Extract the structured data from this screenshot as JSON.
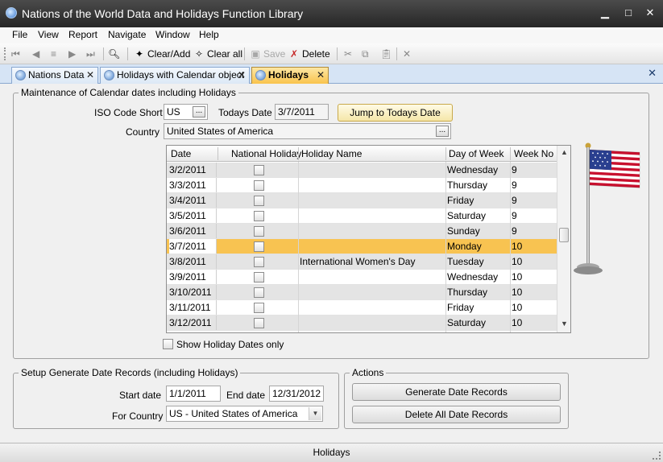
{
  "window": {
    "title": "Nations of the World Data and Holidays Function Library",
    "min": "▁",
    "max": "□",
    "close": "✕"
  },
  "menu": [
    "File",
    "View",
    "Report",
    "Navigate",
    "Window",
    "Help"
  ],
  "toolbar": {
    "clear_add": "Clear/Add",
    "clear_all": "Clear all",
    "save": "Save",
    "delete": "Delete"
  },
  "tabs": [
    {
      "label": "Nations Data",
      "active": false
    },
    {
      "label": "Holidays with Calendar object",
      "active": false
    },
    {
      "label": "Holidays",
      "active": true
    }
  ],
  "maint": {
    "legend": "Maintenance of Calendar dates including Holidays",
    "iso_label": "ISO Code Short",
    "iso_value": "US",
    "todays_label": "Todays Date",
    "todays_value": "3/7/2011",
    "jump_button": "Jump to Todays Date",
    "country_label": "Country",
    "country_value": "United States of America",
    "ellipsis": "...",
    "show_holidays_only": "Show Holiday Dates only"
  },
  "grid": {
    "columns": [
      "Date",
      "National Holiday",
      "Holiday Name",
      "Day of Week",
      "Week No"
    ],
    "rows": [
      {
        "date": "3/2/2011",
        "holiday": false,
        "name": "",
        "day": "Wednesday",
        "week": "9"
      },
      {
        "date": "3/3/2011",
        "holiday": false,
        "name": "",
        "day": "Thursday",
        "week": "9"
      },
      {
        "date": "3/4/2011",
        "holiday": false,
        "name": "",
        "day": "Friday",
        "week": "9"
      },
      {
        "date": "3/5/2011",
        "holiday": false,
        "name": "",
        "day": "Saturday",
        "week": "9"
      },
      {
        "date": "3/6/2011",
        "holiday": false,
        "name": "",
        "day": "Sunday",
        "week": "9"
      },
      {
        "date": "3/7/2011",
        "holiday": false,
        "name": "",
        "day": "Monday",
        "week": "10"
      },
      {
        "date": "3/8/2011",
        "holiday": false,
        "name": "International Women's Day",
        "day": "Tuesday",
        "week": "10"
      },
      {
        "date": "3/9/2011",
        "holiday": false,
        "name": "",
        "day": "Wednesday",
        "week": "10"
      },
      {
        "date": "3/10/2011",
        "holiday": false,
        "name": "",
        "day": "Thursday",
        "week": "10"
      },
      {
        "date": "3/11/2011",
        "holiday": false,
        "name": "",
        "day": "Friday",
        "week": "10"
      },
      {
        "date": "3/12/2011",
        "holiday": false,
        "name": "",
        "day": "Saturday",
        "week": "10"
      }
    ],
    "selected_index": 5
  },
  "setup": {
    "legend": "Setup Generate Date Records (including Holidays)",
    "start_label": "Start date",
    "start_value": "1/1/2011",
    "end_label": "End date",
    "end_value": "12/31/2012",
    "country_label": "For Country",
    "country_value": "US - United States of America"
  },
  "actions": {
    "legend": "Actions",
    "generate": "Generate Date Records",
    "delete_all": "Delete All Date Records"
  },
  "status": {
    "text": "Holidays"
  }
}
